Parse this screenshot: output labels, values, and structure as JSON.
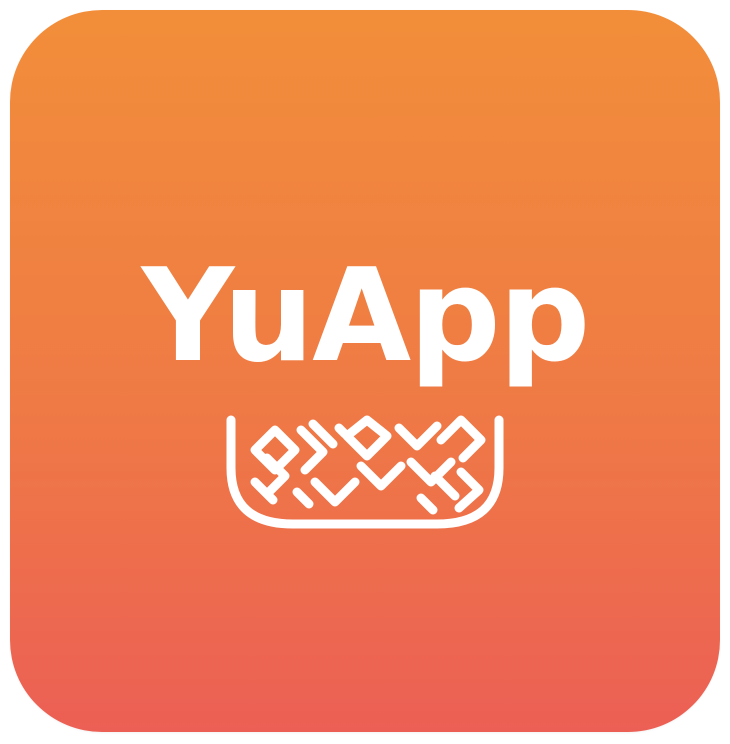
{
  "app_icon": {
    "name": "YuApp",
    "emblem_icon": "woven-basket-pattern-icon",
    "colors": {
      "gradient_top": "#F28E3A",
      "gradient_bottom": "#EC5F55",
      "foreground": "#FFFFFF"
    }
  }
}
